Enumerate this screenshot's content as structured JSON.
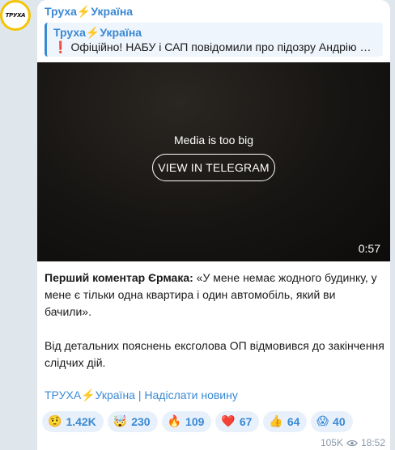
{
  "channel": {
    "avatar_text": "ТРУХА",
    "name_part1": "Труха",
    "bolt": "⚡",
    "name_part2": "Україна"
  },
  "reply": {
    "title_part1": "Труха",
    "title_bolt": "⚡",
    "title_part2": "Україна",
    "excl": "❗",
    "text": "Офіційно! НАБУ і САП повідомили про підозру Андрію Єрмаку"
  },
  "media": {
    "message": "Media is too big",
    "button_label": "VIEW IN TELEGRAM",
    "duration": "0:57"
  },
  "post": {
    "bold_lead": "Перший коментар Єрмака:",
    "quote": " «У мене немає жодного будинку, у мене є тільки одна квартира і один автомобіль, який ви бачили».",
    "paragraph2": "Від детальних пояснень ексголова ОП відмовився до закінчення слідчих дій."
  },
  "links": {
    "link1_part1": "ТРУХА",
    "link1_bolt": "⚡",
    "link1_part2": "Україна",
    "separator": " | ",
    "link2": "Надіслати новину"
  },
  "reactions": [
    {
      "emoji": "🤨",
      "icon": "raised-eyebrow-face",
      "count": "1.42K"
    },
    {
      "emoji": "🤯",
      "icon": "exploding-head",
      "count": "230"
    },
    {
      "emoji": "🔥",
      "icon": "fire",
      "count": "109"
    },
    {
      "emoji": "❤️",
      "icon": "red-heart",
      "count": "67"
    },
    {
      "emoji": "👍",
      "icon": "thumbs-up",
      "count": "64"
    },
    {
      "emoji": "😱",
      "icon": "screaming-face",
      "count": "40"
    }
  ],
  "footer": {
    "views": "105K",
    "time": "18:52"
  },
  "colors": {
    "accent": "#3a89d3",
    "bolt": "#f5a623",
    "avatar_ring": "#f5c400"
  }
}
